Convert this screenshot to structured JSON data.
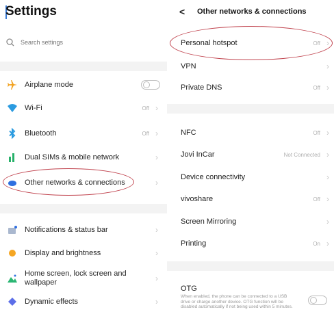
{
  "left": {
    "title": "Settings",
    "search_placeholder": "Search settings",
    "group1": [
      {
        "label": "Airplane mode",
        "value": "",
        "icon": "airplane-icon",
        "color": "#f2a11e",
        "control": "toggle"
      },
      {
        "label": "Wi-Fi",
        "value": "Off",
        "icon": "wifi-icon",
        "color": "#2b9be0",
        "control": "chevron"
      },
      {
        "label": "Bluetooth",
        "value": "Off",
        "icon": "bluetooth-icon",
        "color": "#2b9be0",
        "control": "chevron"
      },
      {
        "label": "Dual SIMs & mobile network",
        "value": "",
        "icon": "sim-icon",
        "color": "#27b16a",
        "control": "chevron"
      },
      {
        "label": "Other networks & connections",
        "value": "",
        "icon": "connections-icon",
        "color": "#2f6fe0",
        "control": "chevron"
      }
    ],
    "group2": [
      {
        "label": "Notifications & status bar",
        "value": "",
        "icon": "notification-icon",
        "color": "#8fa3c4",
        "control": "chevron"
      },
      {
        "label": "Display and brightness",
        "value": "",
        "icon": "brightness-icon",
        "color": "#f5a623",
        "control": "chevron"
      },
      {
        "label": "Home screen, lock screen and wallpaper",
        "value": "",
        "icon": "wallpaper-icon",
        "color": "#2bb673",
        "control": "chevron"
      },
      {
        "label": "Dynamic effects",
        "value": "",
        "icon": "effects-icon",
        "color": "#5c6ee8",
        "control": "chevron"
      }
    ]
  },
  "right": {
    "back_label": "<",
    "title": "Other networks & connections",
    "group1": [
      {
        "label": "Personal hotspot",
        "value": "Off"
      },
      {
        "label": "VPN",
        "value": ""
      },
      {
        "label": "Private DNS",
        "value": "Off"
      }
    ],
    "group2": [
      {
        "label": "NFC",
        "value": "Off"
      },
      {
        "label": "Jovi InCar",
        "value": "Not Connected"
      },
      {
        "label": "Device connectivity",
        "value": ""
      },
      {
        "label": "vivoshare",
        "value": "Off"
      },
      {
        "label": "Screen Mirroring",
        "value": ""
      },
      {
        "label": "Printing",
        "value": "On"
      }
    ],
    "otg": {
      "label": "OTG",
      "description": "When enabled, the phone can be connected to a USB drive or charge another device. OTG function will be disabled automatically if not being used within 5 minutes."
    }
  },
  "colors": {
    "accent": "#3a7bd5",
    "highlight_oval": "#c0424d"
  }
}
